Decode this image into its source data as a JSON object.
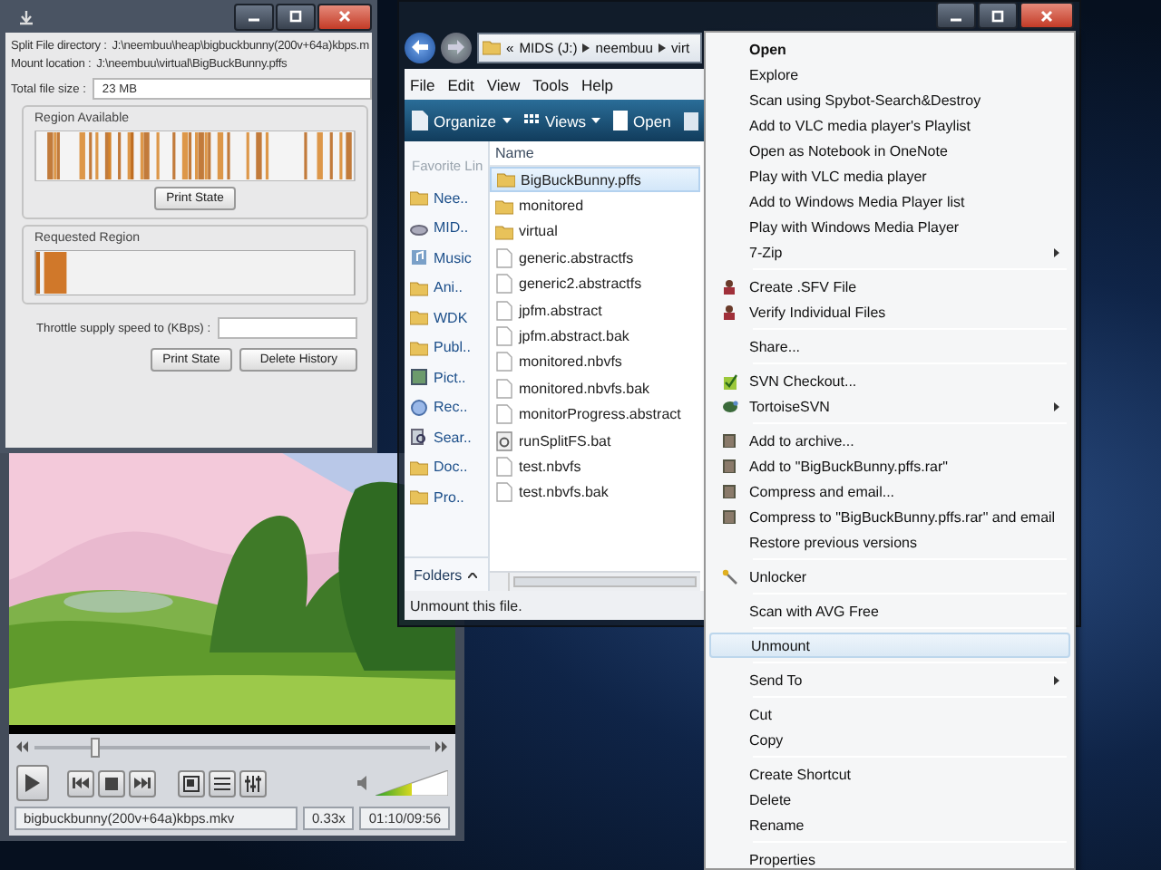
{
  "split_window": {
    "fields": [
      {
        "label": "Split File directory :",
        "value": "J:\\neembuu\\heap\\bigbuckbunny(200v+64a)kbps.m"
      },
      {
        "label": "Mount location :",
        "value": "J:\\neembuu\\virtual\\BigBuckBunny.pffs"
      }
    ],
    "total_size": {
      "label": "Total file size :",
      "value": "23 MB"
    },
    "region_available": {
      "title": "Region Available",
      "button": "Print State"
    },
    "requested_region": {
      "title": "Requested Region"
    },
    "throttle": {
      "label": "Throttle supply speed to (KBps) :"
    },
    "buttons": [
      "Print State",
      "Delete History"
    ]
  },
  "media_player": {
    "seek": {
      "level": 0.15
    },
    "volume": {
      "level": 0.5
    },
    "file_name": "bigbuckbunny(200v+64a)kbps.mkv",
    "speed": "0.33x",
    "time": "01:10/09:56"
  },
  "explorer": {
    "breadcrumb_prefix": "«",
    "breadcrumb": [
      "MIDS (J:)",
      "neembuu",
      "virt"
    ],
    "menu": [
      "File",
      "Edit",
      "View",
      "Tools",
      "Help"
    ],
    "toolbar": [
      {
        "kind": "organize",
        "label": "Organize",
        "dropdown": true
      },
      {
        "kind": "views",
        "label": "Views",
        "dropdown": true
      },
      {
        "kind": "open",
        "label": "Open",
        "dropdown": false
      }
    ],
    "nav_header": "Favorite Lin",
    "nav": [
      {
        "kind": "folder",
        "label": "Nee.."
      },
      {
        "kind": "drive",
        "label": "MID.."
      },
      {
        "kind": "music",
        "label": "Music"
      },
      {
        "kind": "folder",
        "label": "Ani.."
      },
      {
        "kind": "folder",
        "label": "WDK"
      },
      {
        "kind": "folder",
        "label": "Publ.."
      },
      {
        "kind": "pictures",
        "label": "Pict.."
      },
      {
        "kind": "recent",
        "label": "Rec.."
      },
      {
        "kind": "search",
        "label": "Sear.."
      },
      {
        "kind": "folder",
        "label": "Doc.."
      },
      {
        "kind": "folder",
        "label": "Pro.."
      }
    ],
    "folders_button": "Folders",
    "column": "Name",
    "files": [
      {
        "kind": "folder",
        "name": "BigBuckBunny.pffs",
        "selected": true
      },
      {
        "kind": "folder",
        "name": "monitored",
        "selected": false
      },
      {
        "kind": "folder",
        "name": "virtual",
        "selected": false
      },
      {
        "kind": "file",
        "name": "generic.abstractfs",
        "selected": false
      },
      {
        "kind": "file",
        "name": "generic2.abstractfs",
        "selected": false
      },
      {
        "kind": "file",
        "name": "jpfm.abstract",
        "selected": false
      },
      {
        "kind": "file",
        "name": "jpfm.abstract.bak",
        "selected": false
      },
      {
        "kind": "file",
        "name": "monitored.nbvfs",
        "selected": false
      },
      {
        "kind": "file",
        "name": "monitored.nbvfs.bak",
        "selected": false
      },
      {
        "kind": "file",
        "name": "monitorProgress.abstract",
        "selected": false
      },
      {
        "kind": "batch",
        "name": "runSplitFS.bat",
        "selected": false
      },
      {
        "kind": "file",
        "name": "test.nbvfs",
        "selected": false
      },
      {
        "kind": "file",
        "name": "test.nbvfs.bak",
        "selected": false
      }
    ],
    "status": "Unmount this file."
  },
  "context_menu": {
    "groups": [
      [
        {
          "kind": "default",
          "label": "Open",
          "submenu": false,
          "selected": false
        },
        {
          "kind": "plain",
          "label": "Explore",
          "submenu": false,
          "selected": false
        },
        {
          "kind": "plain",
          "label": "Scan using Spybot-Search&Destroy",
          "submenu": false,
          "selected": false
        },
        {
          "kind": "plain",
          "label": "Add to VLC media player's Playlist",
          "submenu": false,
          "selected": false
        },
        {
          "kind": "plain",
          "label": "Open as Notebook in OneNote",
          "submenu": false,
          "selected": false
        },
        {
          "kind": "plain",
          "label": "Play with VLC media player",
          "submenu": false,
          "selected": false
        },
        {
          "kind": "plain",
          "label": "Add to Windows Media Player list",
          "submenu": false,
          "selected": false
        },
        {
          "kind": "plain",
          "label": "Play with Windows Media Player",
          "submenu": false,
          "selected": false
        },
        {
          "kind": "plain",
          "label": "7-Zip",
          "submenu": true,
          "selected": false
        }
      ],
      [
        {
          "kind": "sfv",
          "label": "Create .SFV File",
          "submenu": false,
          "selected": false
        },
        {
          "kind": "sfv",
          "label": "Verify Individual Files",
          "submenu": false,
          "selected": false
        }
      ],
      [
        {
          "kind": "plain",
          "label": "Share...",
          "submenu": false,
          "selected": false
        }
      ],
      [
        {
          "kind": "svn-checkout",
          "label": "SVN Checkout...",
          "submenu": false,
          "selected": false
        },
        {
          "kind": "tortoise",
          "label": "TortoiseSVN",
          "submenu": true,
          "selected": false
        }
      ],
      [
        {
          "kind": "archive",
          "label": "Add to archive...",
          "submenu": false,
          "selected": false
        },
        {
          "kind": "archive",
          "label": "Add to \"BigBuckBunny.pffs.rar\"",
          "submenu": false,
          "selected": false
        },
        {
          "kind": "archive",
          "label": "Compress and email...",
          "submenu": false,
          "selected": false
        },
        {
          "kind": "archive",
          "label": "Compress to \"BigBuckBunny.pffs.rar\" and email",
          "submenu": false,
          "selected": false
        },
        {
          "kind": "plain",
          "label": "Restore previous versions",
          "submenu": false,
          "selected": false
        }
      ],
      [
        {
          "kind": "unlocker",
          "label": "Unlocker",
          "submenu": false,
          "selected": false
        }
      ],
      [
        {
          "kind": "plain",
          "label": "Scan with AVG Free",
          "submenu": false,
          "selected": false
        }
      ],
      [
        {
          "kind": "plain",
          "label": "Unmount",
          "submenu": false,
          "selected": true
        }
      ],
      [
        {
          "kind": "plain",
          "label": "Send To",
          "submenu": true,
          "selected": false
        }
      ],
      [
        {
          "kind": "plain",
          "label": "Cut",
          "submenu": false,
          "selected": false
        },
        {
          "kind": "plain",
          "label": "Copy",
          "submenu": false,
          "selected": false
        }
      ],
      [
        {
          "kind": "plain",
          "label": "Create Shortcut",
          "submenu": false,
          "selected": false
        },
        {
          "kind": "plain",
          "label": "Delete",
          "submenu": false,
          "selected": false
        },
        {
          "kind": "plain",
          "label": "Rename",
          "submenu": false,
          "selected": false
        }
      ],
      [
        {
          "kind": "plain",
          "label": "Properties",
          "submenu": false,
          "selected": false
        }
      ]
    ]
  }
}
